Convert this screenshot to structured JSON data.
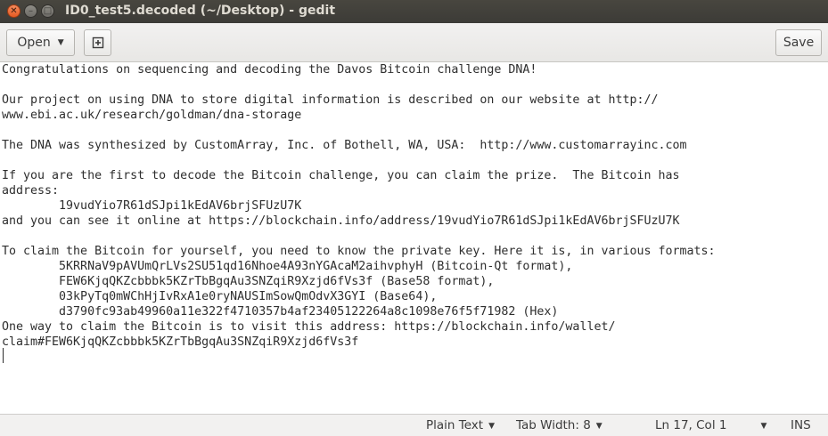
{
  "window": {
    "title": "ID0_test5.decoded (~/Desktop) - gedit"
  },
  "toolbar": {
    "open_label": "Open",
    "save_label": "Save"
  },
  "editor": {
    "lines": [
      "Congratulations on sequencing and decoding the Davos Bitcoin challenge DNA!",
      "",
      "Our project on using DNA to store digital information is described on our website at http://",
      "www.ebi.ac.uk/research/goldman/dna-storage",
      "",
      "The DNA was synthesized by CustomArray, Inc. of Bothell, WA, USA:  http://www.customarrayinc.com",
      "",
      "If you are the first to decode the Bitcoin challenge, you can claim the prize.  The Bitcoin has",
      "address:",
      "        19vudYio7R61dSJpi1kEdAV6brjSFUzU7K",
      "and you can see it online at https://blockchain.info/address/19vudYio7R61dSJpi1kEdAV6brjSFUzU7K",
      "",
      "To claim the Bitcoin for yourself, you need to know the private key. Here it is, in various formats:",
      "        5KRRNaV9pAVUmQrLVs2SU51qd16Nhoe4A93nYGAcaM2aihvphyH (Bitcoin-Qt format),",
      "        FEW6KjqQKZcbbbk5KZrTbBgqAu3SNZqiR9Xzjd6fVs3f (Base58 format),",
      "        03kPyTq0mWChHjIvRxA1e0ryNAUSImSowQmOdvX3GYI (Base64),",
      "        d3790fc93ab49960a11e322f4710357b4af23405122264a8c1098e76f5f71982 (Hex)",
      "One way to claim the Bitcoin is to visit this address: https://blockchain.info/wallet/",
      "claim#FEW6KjqQKZcbbbk5KZrTbBgqAu3SNZqiR9Xzjd6fVs3f"
    ]
  },
  "statusbar": {
    "language": "Plain Text",
    "tab_width": "Tab Width: 8",
    "position": "Ln 17, Col 1",
    "mode": "INS"
  }
}
